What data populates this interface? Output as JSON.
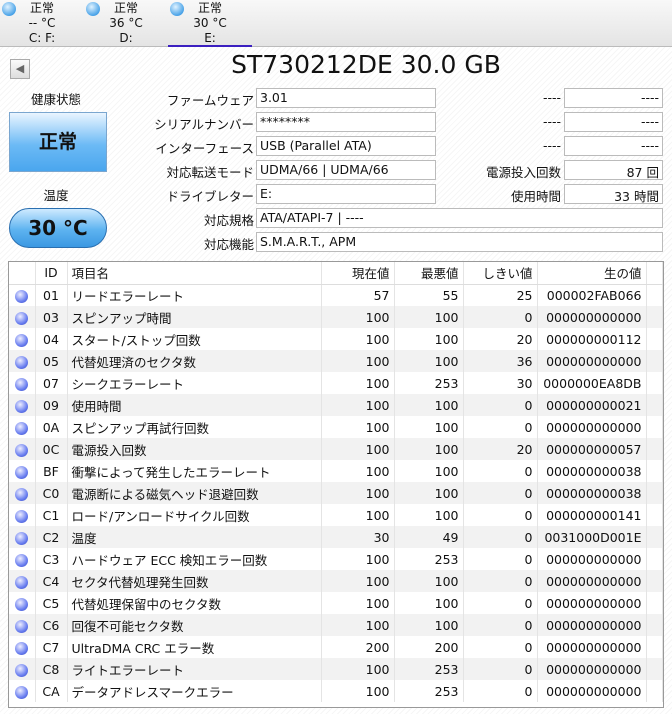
{
  "drives": [
    {
      "status": "正常",
      "temp": "-- °C",
      "letter": "C: F:"
    },
    {
      "status": "正常",
      "temp": "36 °C",
      "letter": "D:"
    },
    {
      "status": "正常",
      "temp": "30 °C",
      "letter": "E:"
    }
  ],
  "title": "ST730212DE 30.0 GB",
  "health_label": "健康状態",
  "health": "正常",
  "temp_label": "温度",
  "temp": "30 °C",
  "info": {
    "firmware_label": "ファームウェア",
    "firmware": "3.01",
    "serial_label": "シリアルナンバー",
    "serial": "********",
    "interface_label": "インターフェース",
    "interface": "USB (Parallel ATA)",
    "transfer_label": "対応転送モード",
    "transfer": "UDMA/66 | UDMA/66",
    "letter_label": "ドライブレター",
    "letter": "E:",
    "standard_label": "対応規格",
    "standard": "ATA/ATAPI-7 | ----",
    "features_label": "対応機能",
    "features": "S.M.A.R.T., APM",
    "r1_label": "----",
    "r1": "----",
    "r2_label": "----",
    "r2": "----",
    "r3_label": "----",
    "r3": "----",
    "power_count_label": "電源投入回数",
    "power_count": "87 回",
    "power_hours_label": "使用時間",
    "power_hours": "33 時間"
  },
  "columns": [
    "ID",
    "項目名",
    "現在値",
    "最悪値",
    "しきい値",
    "生の値"
  ],
  "rows": [
    [
      "01",
      "リードエラーレート",
      "57",
      "55",
      "25",
      "000002FAB066"
    ],
    [
      "03",
      "スピンアップ時間",
      "100",
      "100",
      "0",
      "000000000000"
    ],
    [
      "04",
      "スタート/ストップ回数",
      "100",
      "100",
      "20",
      "000000000112"
    ],
    [
      "05",
      "代替処理済のセクタ数",
      "100",
      "100",
      "36",
      "000000000000"
    ],
    [
      "07",
      "シークエラーレート",
      "100",
      "253",
      "30",
      "0000000EA8DB"
    ],
    [
      "09",
      "使用時間",
      "100",
      "100",
      "0",
      "000000000021"
    ],
    [
      "0A",
      "スピンアップ再試行回数",
      "100",
      "100",
      "0",
      "000000000000"
    ],
    [
      "0C",
      "電源投入回数",
      "100",
      "100",
      "20",
      "000000000057"
    ],
    [
      "BF",
      "衝撃によって発生したエラーレート",
      "100",
      "100",
      "0",
      "000000000038"
    ],
    [
      "C0",
      "電源断による磁気ヘッド退避回数",
      "100",
      "100",
      "0",
      "000000000038"
    ],
    [
      "C1",
      "ロード/アンロードサイクル回数",
      "100",
      "100",
      "0",
      "000000000141"
    ],
    [
      "C2",
      "温度",
      "30",
      "49",
      "0",
      "0031000D001E"
    ],
    [
      "C3",
      "ハードウェア ECC 検知エラー回数",
      "100",
      "253",
      "0",
      "000000000000"
    ],
    [
      "C4",
      "セクタ代替処理発生回数",
      "100",
      "100",
      "0",
      "000000000000"
    ],
    [
      "C5",
      "代替処理保留中のセクタ数",
      "100",
      "100",
      "0",
      "000000000000"
    ],
    [
      "C6",
      "回復不可能セクタ数",
      "100",
      "100",
      "0",
      "000000000000"
    ],
    [
      "C7",
      "UltraDMA CRC エラー数",
      "200",
      "200",
      "0",
      "000000000000"
    ],
    [
      "C8",
      "ライトエラーレート",
      "100",
      "253",
      "0",
      "000000000000"
    ],
    [
      "CA",
      "データアドレスマークエラー",
      "100",
      "253",
      "0",
      "000000000000"
    ]
  ]
}
